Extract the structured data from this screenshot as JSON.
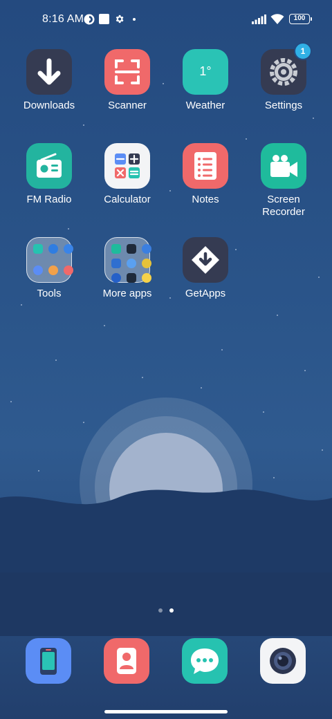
{
  "status_bar": {
    "time": "8:16 AM",
    "battery": "100",
    "icons": [
      "notification-app-icon",
      "square-notification-icon",
      "gear-icon",
      "dot-icon",
      "signal-icon",
      "wifi-icon",
      "battery-icon"
    ]
  },
  "apps": [
    {
      "label": "Downloads",
      "icon": "download-icon",
      "color": "#353b52"
    },
    {
      "label": "Scanner",
      "icon": "scan-icon",
      "color": "#f0696a"
    },
    {
      "label": "Weather",
      "icon_text": "1°",
      "icon": "weather-icon",
      "color": "#2ac3b5"
    },
    {
      "label": "Settings",
      "icon": "gear-icon",
      "color": "#353b52",
      "badge": "1"
    },
    {
      "label": "FM Radio",
      "icon": "radio-icon",
      "color": "#23b49f"
    },
    {
      "label": "Calculator",
      "icon": "calculator-icon",
      "color": "#f3f4f6"
    },
    {
      "label": "Notes",
      "icon": "notes-icon",
      "color": "#f0696a"
    },
    {
      "label": "Screen Recorder",
      "label_line1": "Screen",
      "label_line2": "Recorder",
      "icon": "video-camera-icon",
      "color": "#1fbb9c"
    },
    {
      "label": "Tools",
      "icon": "folder-icon"
    },
    {
      "label": "More apps",
      "icon": "folder-icon"
    },
    {
      "label": "GetApps",
      "icon": "getapps-icon",
      "color": "#353b52"
    }
  ],
  "home_pages": {
    "count": 2,
    "active": 2
  },
  "dock": [
    {
      "name": "phone",
      "icon": "phone-icon",
      "color": "#5b8df5"
    },
    {
      "name": "contacts",
      "icon": "contacts-icon",
      "color": "#f0696a"
    },
    {
      "name": "messages",
      "icon": "messages-icon",
      "color": "#26c2b0"
    },
    {
      "name": "camera",
      "icon": "camera-icon",
      "color": "#f3f4f6"
    }
  ]
}
